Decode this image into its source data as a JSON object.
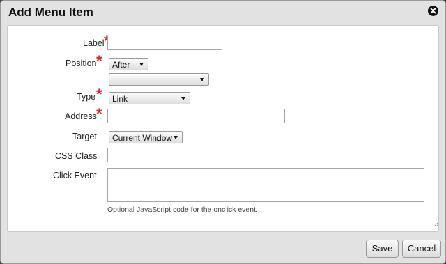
{
  "dialog": {
    "title": "Add Menu Item",
    "close_icon": "close-icon"
  },
  "form": {
    "label": {
      "text": "Label",
      "required": true,
      "value": ""
    },
    "position": {
      "text": "Position",
      "required": true,
      "selected": "After",
      "target_selected": ""
    },
    "type": {
      "text": "Type",
      "required": true,
      "selected": "Link"
    },
    "address": {
      "text": "Address",
      "required": true,
      "value": ""
    },
    "target": {
      "text": "Target",
      "selected": "Current Window"
    },
    "css_class": {
      "text": "CSS Class",
      "value": ""
    },
    "click_event": {
      "text": "Click Event",
      "value": "",
      "hint": "Optional JavaScript code for the onclick event."
    },
    "required_marker": "*"
  },
  "buttons": {
    "save": "Save",
    "cancel": "Cancel"
  },
  "colors": {
    "required": "#e2202a",
    "dialog_bg": "#e2e2e2",
    "panel_bg": "#ffffff"
  }
}
